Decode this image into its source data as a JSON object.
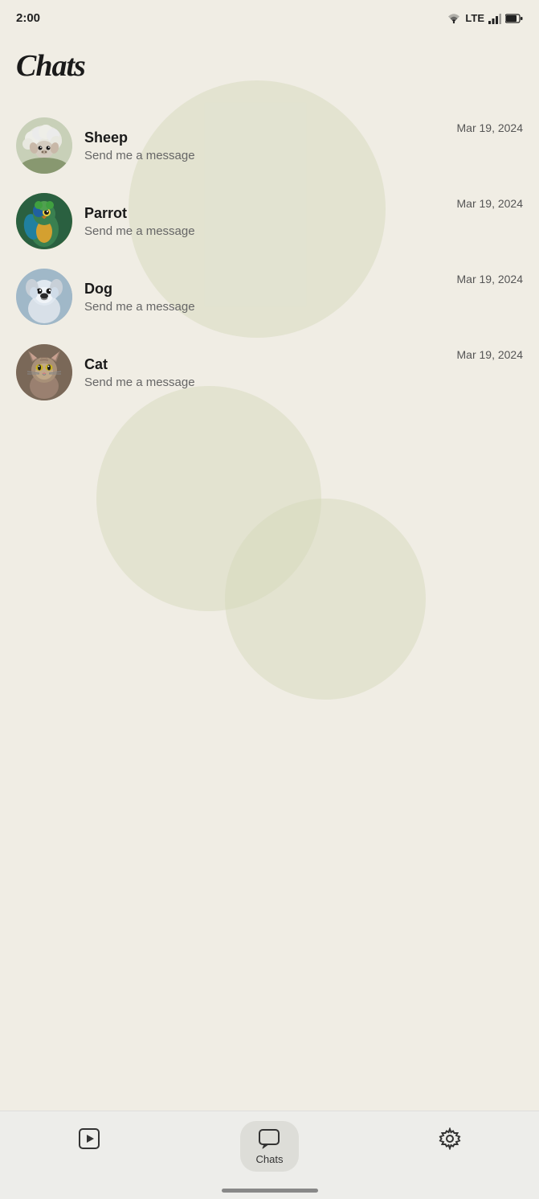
{
  "statusBar": {
    "time": "2:00",
    "lteLabel": "LTE"
  },
  "pageTitle": "Chats",
  "chats": [
    {
      "id": "sheep",
      "name": "Sheep",
      "preview": "Send me a message",
      "date": "Mar 19, 2024",
      "avatarType": "sheep",
      "avatarColor1": "#d0d8c0",
      "avatarColor2": "#a8b898"
    },
    {
      "id": "parrot",
      "name": "Parrot",
      "preview": "Send me a message",
      "date": "Mar 19, 2024",
      "avatarType": "parrot",
      "avatarColor1": "#3a7a50",
      "avatarColor2": "#c89830"
    },
    {
      "id": "dog",
      "name": "Dog",
      "preview": "Send me a message",
      "date": "Mar 19, 2024",
      "avatarType": "dog",
      "avatarColor1": "#b8ccd8",
      "avatarColor2": "#708898"
    },
    {
      "id": "cat",
      "name": "Cat",
      "preview": "Send me a message",
      "date": "Mar 19, 2024",
      "avatarType": "cat",
      "avatarColor1": "#a89080",
      "avatarColor2": "#685848"
    }
  ],
  "bottomNav": {
    "items": [
      {
        "id": "stories",
        "label": "",
        "icon": "play-square",
        "active": false
      },
      {
        "id": "chats",
        "label": "Chats",
        "icon": "chat-bubble",
        "active": true
      },
      {
        "id": "settings",
        "label": "",
        "icon": "gear",
        "active": false
      }
    ]
  }
}
